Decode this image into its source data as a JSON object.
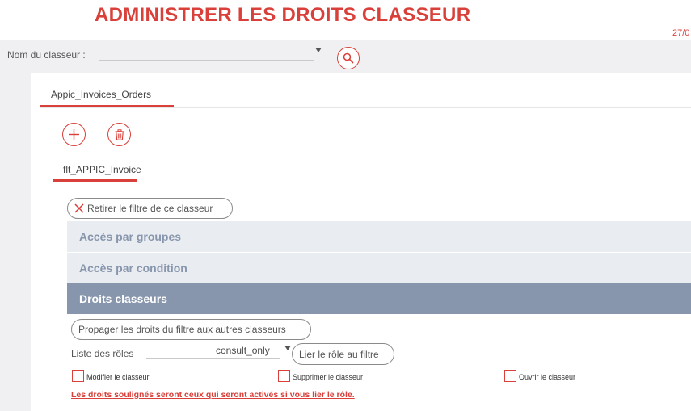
{
  "page_title": "ADMINISTRER LES DROITS CLASSEUR",
  "date_fragment": "27/0",
  "search": {
    "label": "Nom du classeur :",
    "value": "",
    "icons": {
      "dropdown": "chevron-down-icon",
      "search": "search-icon"
    }
  },
  "classeur_tab": {
    "label": "Appic_Invoices_Orders"
  },
  "actions": {
    "add_icon": "plus-icon",
    "delete_icon": "trash-icon"
  },
  "filter_tab": {
    "label": "flt_APPIC_Invoice"
  },
  "remove_filter_button": {
    "label": "Retirer le filtre de ce classeur",
    "icon": "close-icon"
  },
  "accordions": [
    {
      "label": "Accès par groupes",
      "expanded": false
    },
    {
      "label": "Accès par condition",
      "expanded": false
    },
    {
      "label": "Droits classeurs",
      "expanded": true
    }
  ],
  "propagate_button": {
    "label": "Propager les droits du filtre aux autres classeurs"
  },
  "roles": {
    "label": "Liste des rôles",
    "selected": "consult_only",
    "link_button": "Lier le rôle au filtre"
  },
  "permissions": [
    {
      "label": "Modifier le classeur",
      "checked": false
    },
    {
      "label": "Supprimer le classeur",
      "checked": false
    },
    {
      "label": "Ouvrir le classeur",
      "checked": false
    }
  ],
  "warning": "Les droits soulignés seront ceux qui seront activés si vous lier le rôle.",
  "colors": {
    "accent": "#d9403a",
    "section_active": "#8796ad",
    "section_inactive": "#e9ecf1"
  }
}
